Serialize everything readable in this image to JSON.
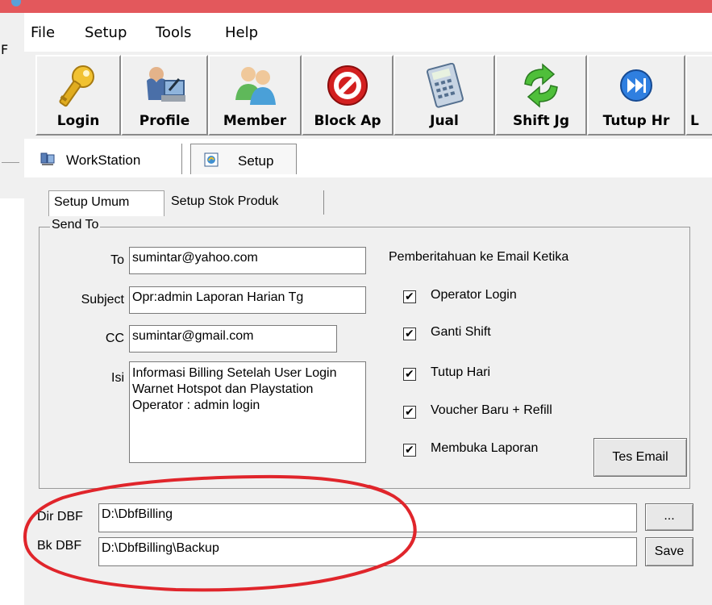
{
  "menu": {
    "items": [
      "File",
      "Setup",
      "Tools",
      "Help"
    ]
  },
  "side_letter": "F",
  "toolbar": {
    "buttons": [
      {
        "label": "Login",
        "icon": "key-icon"
      },
      {
        "label": "Profile",
        "icon": "profile-icon"
      },
      {
        "label": "Member",
        "icon": "members-icon"
      },
      {
        "label": "Block Ap",
        "icon": "block-icon"
      },
      {
        "label": "Jual",
        "icon": "calculator-icon"
      },
      {
        "label": "Shift Jg",
        "icon": "refresh-arrows-icon"
      },
      {
        "label": "Tutup Hr",
        "icon": "fast-forward-icon"
      },
      {
        "label": "L",
        "icon": ""
      }
    ]
  },
  "outer_tabs": [
    {
      "label": "WorkStation",
      "icon": "workstation-icon"
    },
    {
      "label": "Setup",
      "icon": "setup-icon"
    }
  ],
  "inner_tabs": [
    {
      "label": "Setup Umum"
    },
    {
      "label": "Setup Stok Produk"
    }
  ],
  "send_to": {
    "legend": "Send To",
    "to_label": "To",
    "to_value": "sumintar@yahoo.com",
    "subject_label": "Subject",
    "subject_value": "Opr:admin Laporan Harian Tg",
    "cc_label": "CC",
    "cc_value": "sumintar@gmail.com",
    "isi_label": "Isi",
    "isi_value": "Informasi Billing Setelah User Login Warnet Hotspot dan Playstation Operator : admin login"
  },
  "notifications": {
    "title": "Pemberitahuan ke Email Ketika",
    "items": [
      {
        "label": "Operator Login",
        "checked": true
      },
      {
        "label": "Ganti Shift",
        "checked": true
      },
      {
        "label": "Tutup Hari",
        "checked": true
      },
      {
        "label": "Voucher Baru + Refill",
        "checked": true
      },
      {
        "label": "Membuka Laporan",
        "checked": true
      }
    ],
    "check_glyph": "✔"
  },
  "buttons": {
    "tes_email": "Tes Email",
    "browse": "...",
    "save": "Save"
  },
  "paths": {
    "dir_label": "Dir DBF",
    "dir_value": "D:\\DbfBilling",
    "bk_label": "Bk DBF",
    "bk_value": "D:\\DbfBilling\\Backup"
  },
  "colors": {
    "titlebar": "#e3585c",
    "annotation": "#e0252b",
    "panel": "#f0f0f0"
  }
}
